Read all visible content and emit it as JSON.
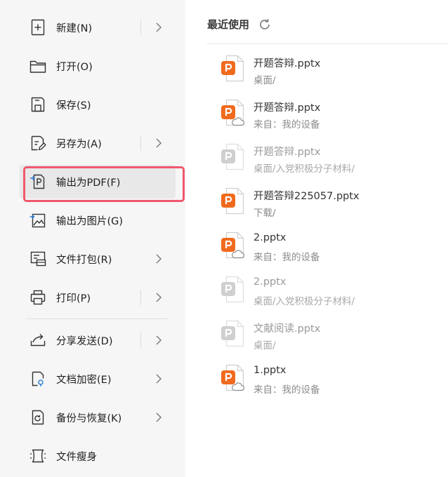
{
  "menu": {
    "items": [
      {
        "label": "新建(N)",
        "icon": "new-file-icon",
        "has_submenu": true
      },
      {
        "label": "打开(O)",
        "icon": "folder-open-icon",
        "has_submenu": false
      },
      {
        "label": "保存(S)",
        "icon": "save-icon",
        "has_submenu": false
      },
      {
        "label": "另存为(A)",
        "icon": "save-as-icon",
        "has_submenu": true
      },
      {
        "label": "输出为PDF(F)",
        "icon": "export-pdf-icon",
        "has_submenu": false,
        "highlighted": true
      },
      {
        "label": "输出为图片(G)",
        "icon": "export-image-icon",
        "has_submenu": false
      },
      {
        "label": "文件打包(R)",
        "icon": "package-icon",
        "has_submenu": true
      },
      {
        "label": "打印(P)",
        "icon": "printer-icon",
        "has_submenu": true
      },
      {
        "label": "分享发送(D)",
        "icon": "share-icon",
        "has_submenu": true
      },
      {
        "label": "文档加密(E)",
        "icon": "encrypt-icon",
        "has_submenu": true
      },
      {
        "label": "备份与恢复(K)",
        "icon": "backup-icon",
        "has_submenu": true
      },
      {
        "label": "文件瘦身",
        "icon": "slim-icon",
        "has_submenu": false
      }
    ]
  },
  "recent": {
    "title": "最近使用",
    "files": [
      {
        "name": "开题答辩.pptx",
        "location": "桌面/",
        "cloud": false,
        "disabled": false
      },
      {
        "name": "开题答辩.pptx",
        "location": "来自：我的设备",
        "cloud": true,
        "disabled": false
      },
      {
        "name": "开题答辩.pptx",
        "location": "桌面/入党积极分子材料/",
        "cloud": false,
        "disabled": true
      },
      {
        "name": "开题答辩225057.pptx",
        "location": "下载/",
        "cloud": false,
        "disabled": false
      },
      {
        "name": "2.pptx",
        "location": "来自：我的设备",
        "cloud": true,
        "disabled": false
      },
      {
        "name": "2.pptx",
        "location": "桌面/入党积极分子材料/",
        "cloud": false,
        "disabled": true
      },
      {
        "name": "文献阅读.pptx",
        "location": "桌面/",
        "cloud": false,
        "disabled": true
      },
      {
        "name": "1.pptx",
        "location": "来自：我的设备",
        "cloud": true,
        "disabled": false
      }
    ]
  },
  "colors": {
    "ppt_orange": "#f06a1e",
    "ppt_disabled": "#cfcfcf",
    "highlight_border": "#f0586e",
    "menu_bg": "#f6f6f6"
  }
}
